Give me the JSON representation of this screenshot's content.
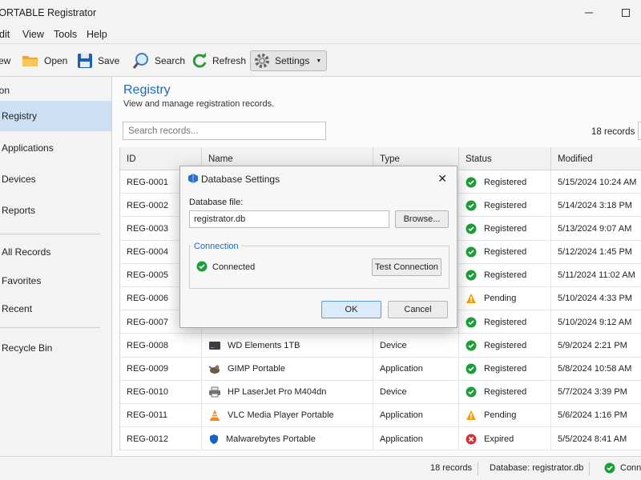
{
  "window": {
    "title": "PORTABLE Registrator"
  },
  "menu": [
    "Edit",
    "View",
    "Tools",
    "Help"
  ],
  "menu_display": [
    "dit",
    "View",
    "Tools",
    "Help"
  ],
  "toolbar": {
    "new": "ew",
    "open": "Open",
    "save": "Save",
    "search": "Search",
    "refresh": "Refresh",
    "settings": "Settings"
  },
  "sidebar": {
    "header": "ition",
    "items": [
      "Registry",
      "Applications",
      "Devices",
      "Reports",
      "All Records",
      "Favorites",
      "Recent",
      "Recycle Bin"
    ]
  },
  "main": {
    "title": "Registry",
    "subtitle": "View and manage registration records.",
    "search_placeholder": "Search records...",
    "count": "18 records"
  },
  "table": {
    "columns": [
      "ID",
      "Name",
      "Type",
      "Status",
      "Modified"
    ],
    "rows": [
      {
        "id": "REG-0001",
        "name": "",
        "type": "",
        "status": "Registered",
        "modified": "5/15/2024 10:24 AM",
        "status_icon": "check-icon",
        "name_icon": ""
      },
      {
        "id": "REG-0002",
        "name": "",
        "type": "",
        "status": "Registered",
        "modified": "5/14/2024 3:18 PM",
        "status_icon": "check-icon",
        "name_icon": ""
      },
      {
        "id": "REG-0003",
        "name": "",
        "type": "",
        "status": "Registered",
        "modified": "5/13/2024 9:07 AM",
        "status_icon": "check-icon",
        "name_icon": ""
      },
      {
        "id": "REG-0004",
        "name": "",
        "type": "",
        "status": "Registered",
        "modified": "5/12/2024 1:45 PM",
        "status_icon": "check-icon",
        "name_icon": ""
      },
      {
        "id": "REG-0005",
        "name": "",
        "type": "",
        "status": "Registered",
        "modified": "5/11/2024 11:02 AM",
        "status_icon": "check-icon",
        "name_icon": ""
      },
      {
        "id": "REG-0006",
        "name": "",
        "type": "",
        "status": "Pending",
        "modified": "5/10/2024 4:33 PM",
        "status_icon": "warning-icon",
        "name_icon": ""
      },
      {
        "id": "REG-0007",
        "name": "",
        "type": "",
        "status": "Registered",
        "modified": "5/10/2024 9:12 AM",
        "status_icon": "check-icon",
        "name_icon": ""
      },
      {
        "id": "REG-0008",
        "name": "WD Elements 1TB",
        "type": "Device",
        "status": "Registered",
        "modified": "5/9/2024 2:21 PM",
        "status_icon": "check-icon",
        "name_icon": "hard-drive-icon"
      },
      {
        "id": "REG-0009",
        "name": "GIMP Portable",
        "type": "Application",
        "status": "Registered",
        "modified": "5/8/2024 10:58 AM",
        "status_icon": "check-icon",
        "name_icon": "gimp-icon"
      },
      {
        "id": "REG-0010",
        "name": "HP LaserJet Pro M404dn",
        "type": "Device",
        "status": "Registered",
        "modified": "5/7/2024 3:39 PM",
        "status_icon": "check-icon",
        "name_icon": "printer-icon"
      },
      {
        "id": "REG-0011",
        "name": "VLC Media Player Portable",
        "type": "Application",
        "status": "Pending",
        "modified": "5/6/2024 1:16 PM",
        "status_icon": "warning-icon",
        "name_icon": "vlc-cone-icon"
      },
      {
        "id": "REG-0012",
        "name": "Malwarebytes Portable",
        "type": "Application",
        "status": "Expired",
        "modified": "5/5/2024 8:41 AM",
        "status_icon": "error-icon",
        "name_icon": "shield-icon"
      }
    ]
  },
  "statusbar": {
    "count": "18 records",
    "database": "Database: registrator.db",
    "connection": "Conne"
  },
  "dialog": {
    "title": "Database Settings",
    "db_label": "Database file:",
    "db_value": "registrator.db",
    "browse": "Browse...",
    "group": "Connection",
    "status": "Connected",
    "test": "Test Connection",
    "ok": "OK",
    "cancel": "Cancel"
  },
  "colors": {
    "accent": "#1a6bbf",
    "selected": "#cde0f3",
    "ok_green": "#1e9e3a",
    "warn": "#f0a30a",
    "error": "#d13438"
  }
}
